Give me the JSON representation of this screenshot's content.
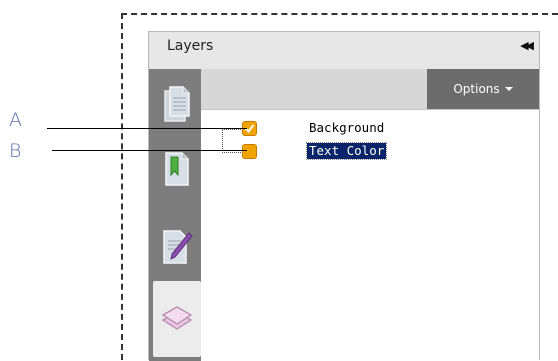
{
  "panel": {
    "title": "Layers",
    "collapse_glyph": "◀◀",
    "options_label": "Options"
  },
  "sidebar": {
    "items": [
      {
        "icon": "pages-icon"
      },
      {
        "icon": "bookmarks-icon"
      },
      {
        "icon": "signatures-icon"
      },
      {
        "icon": "layers-icon"
      }
    ]
  },
  "layers": [
    {
      "label": "Background",
      "checked": true,
      "selected": false
    },
    {
      "label": "Text Color",
      "checked": false,
      "selected": true
    }
  ],
  "callouts": {
    "a": "A",
    "b": "B"
  },
  "colors": {
    "checkbox": "#f0a400",
    "selection": "#0a246a",
    "sidebar": "#7d7d7d",
    "options_bg": "#6c6c6c",
    "callout_text": "#5a6fb0"
  }
}
